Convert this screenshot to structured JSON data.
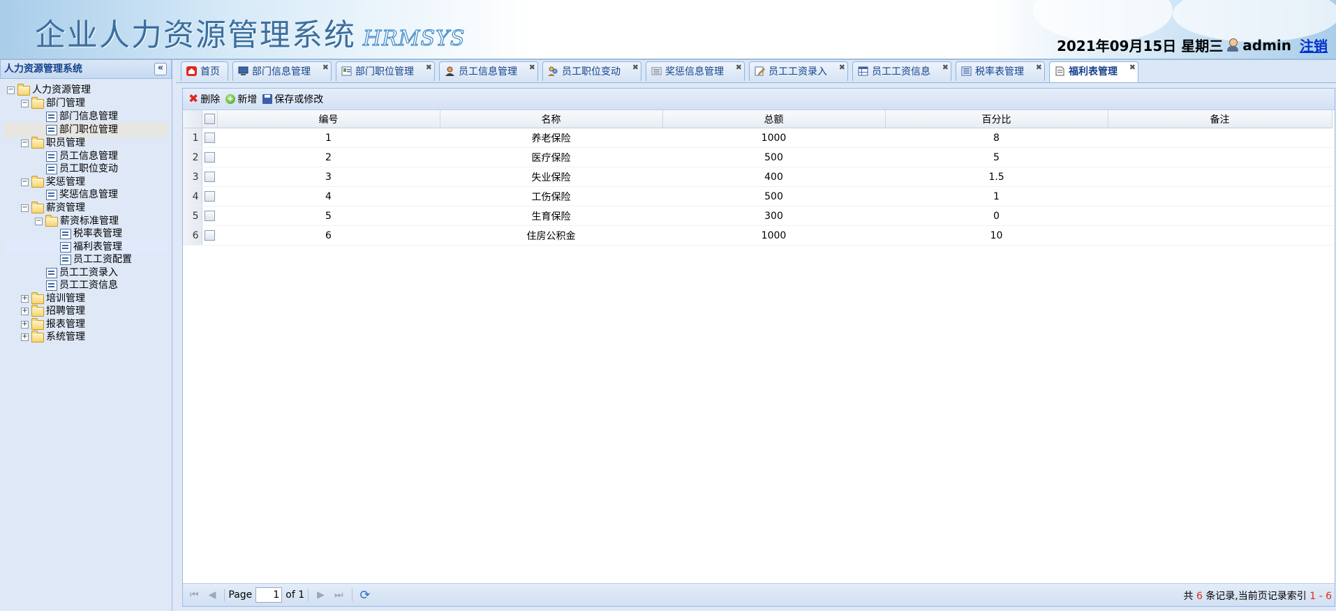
{
  "header": {
    "title": "企业人力资源管理系统",
    "subtitle": "HRMSYS",
    "datetime": "2021年09月15日 星期三",
    "username": "admin",
    "logout_label": "注销"
  },
  "west": {
    "title": "人力资源管理系统",
    "collapse_symbol": "«",
    "tree": {
      "root": "人力资源管理",
      "dept": "部门管理",
      "dept_info": "部门信息管理",
      "dept_position": "部门职位管理",
      "staff": "职员管理",
      "emp_info": "员工信息管理",
      "emp_move": "员工职位变动",
      "reward": "奖惩管理",
      "reward_info": "奖惩信息管理",
      "salary": "薪资管理",
      "salary_std": "薪资标准管理",
      "tax": "税率表管理",
      "welfare": "福利表管理",
      "emp_salary_cfg": "员工工资配置",
      "emp_salary_input": "员工工资录入",
      "emp_salary_info": "员工工资信息",
      "training": "培训管理",
      "recruit": "招聘管理",
      "report": "报表管理",
      "system": "系统管理"
    }
  },
  "tabs": [
    {
      "label": "首页"
    },
    {
      "label": "部门信息管理"
    },
    {
      "label": "部门职位管理"
    },
    {
      "label": "员工信息管理"
    },
    {
      "label": "员工职位变动"
    },
    {
      "label": "奖惩信息管理"
    },
    {
      "label": "员工工资录入"
    },
    {
      "label": "员工工资信息"
    },
    {
      "label": "税率表管理"
    },
    {
      "label": "福利表管理"
    }
  ],
  "toolbar": {
    "delete_label": "删除",
    "add_label": "新增",
    "save_label": "保存或修改"
  },
  "grid": {
    "columns": [
      "编号",
      "名称",
      "总额",
      "百分比",
      "备注"
    ],
    "rows": [
      {
        "n": "1",
        "id": "1",
        "name": "养老保险",
        "total": "1000",
        "percent": "8",
        "note": ""
      },
      {
        "n": "2",
        "id": "2",
        "name": "医疗保险",
        "total": "500",
        "percent": "5",
        "note": ""
      },
      {
        "n": "3",
        "id": "3",
        "name": "失业保险",
        "total": "400",
        "percent": "1.5",
        "note": ""
      },
      {
        "n": "4",
        "id": "4",
        "name": "工伤保险",
        "total": "500",
        "percent": "1",
        "note": ""
      },
      {
        "n": "5",
        "id": "5",
        "name": "生育保险",
        "total": "300",
        "percent": "0",
        "note": ""
      },
      {
        "n": "6",
        "id": "6",
        "name": "住房公积金",
        "total": "1000",
        "percent": "10",
        "note": ""
      }
    ]
  },
  "pager": {
    "page_label": "Page",
    "page_value": "1",
    "of_label": "of 1",
    "info_prefix": "共",
    "info_count": "6",
    "info_middle": "条记录,当前页记录索引",
    "info_range": "1 - 6"
  },
  "colors": {
    "header_title": "#3b6f9f",
    "accent_blue": "#15428b",
    "delete_red": "#e0281e"
  }
}
